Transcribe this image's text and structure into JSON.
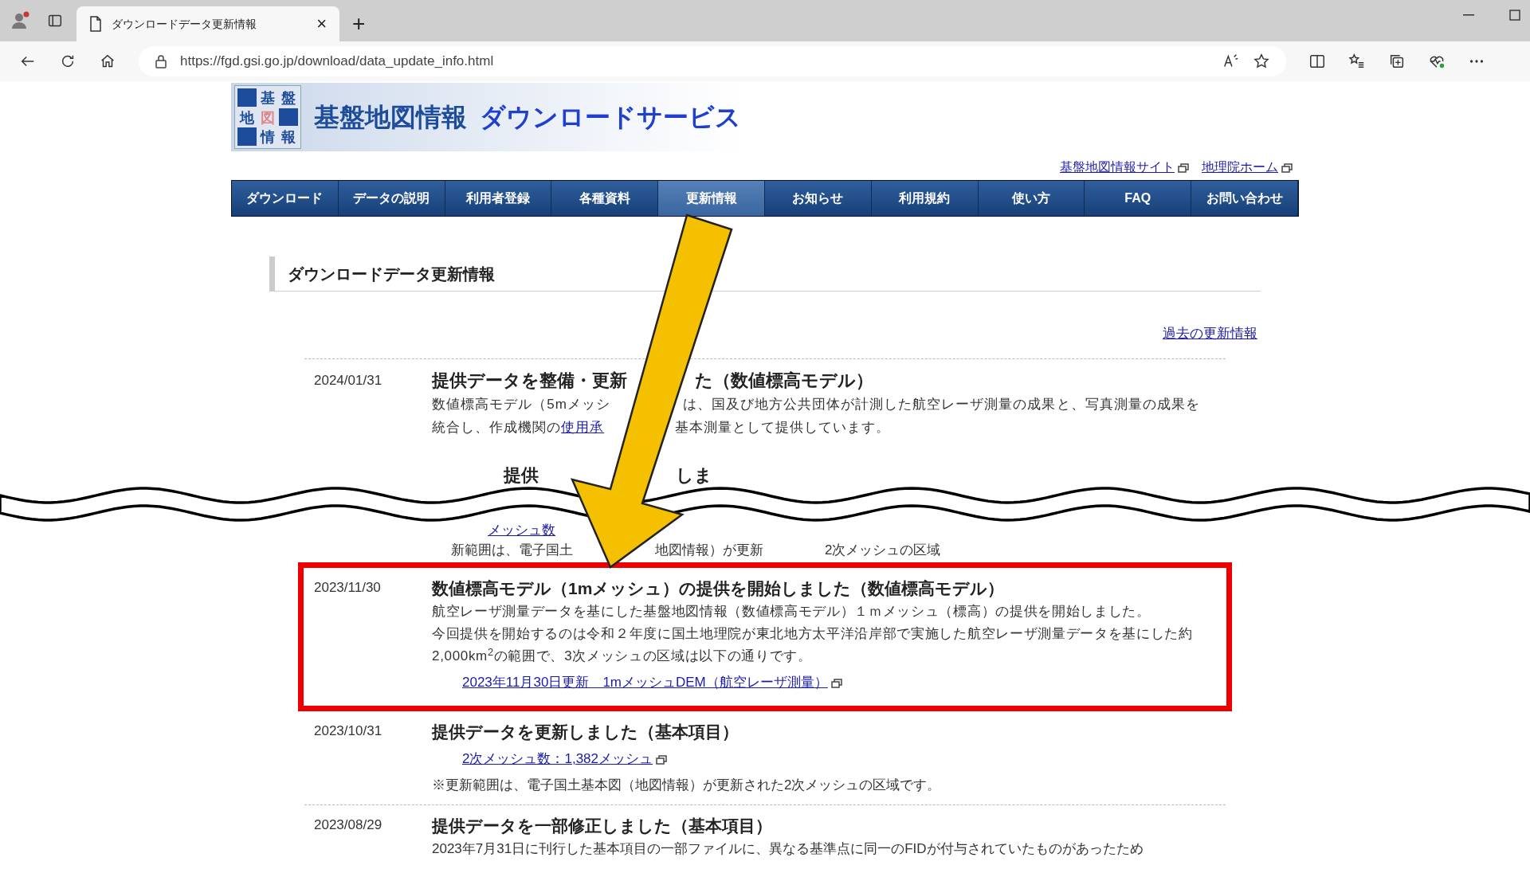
{
  "browser": {
    "tab_title": "ダウンロードデータ更新情報",
    "tab_close": "×",
    "new_tab": "+",
    "url": "https://fgd.gsi.go.jp/download/data_update_info.html"
  },
  "site": {
    "logo_chars": [
      "基",
      "盤",
      "地",
      "図",
      "情",
      "報"
    ],
    "title": "基盤地図情報",
    "subtitle": "ダウンロードサービス",
    "top_links": [
      "基盤地図情報サイト",
      "地理院ホーム"
    ]
  },
  "nav": [
    {
      "label": "ダウンロード",
      "selected": false
    },
    {
      "label": "データの説明",
      "selected": false
    },
    {
      "label": "利用者登録",
      "selected": false
    },
    {
      "label": "各種資料",
      "selected": false
    },
    {
      "label": "更新情報",
      "selected": true
    },
    {
      "label": "お知らせ",
      "selected": false
    },
    {
      "label": "利用規約",
      "selected": false
    },
    {
      "label": "使い方",
      "selected": false
    },
    {
      "label": "FAQ",
      "selected": false
    },
    {
      "label": "お問い合わせ",
      "selected": false
    }
  ],
  "heading": "ダウンロードデータ更新情報",
  "past_link": "過去の更新情報",
  "top_entry": {
    "date": "2024/01/31",
    "title_parts": [
      "提供データを整備・更新",
      "た（数値標高モデル）"
    ],
    "body_lines": [
      [
        {
          "kind": "text",
          "text": "数値標高モデル（5mメッシ"
        },
        {
          "kind": "text",
          "text": "は、国及び地方公共団体が計測した航空レーザ測量の成果と、写真測量の成果を"
        }
      ],
      [
        {
          "kind": "text",
          "text": "統合し、作成機関の"
        },
        {
          "kind": "link",
          "text": "使用承"
        },
        {
          "kind": "text",
          "text": "基本測量として提供しています。"
        }
      ]
    ]
  },
  "cut_fragments": [
    {
      "kind": "title",
      "text": "提供"
    },
    {
      "kind": "title",
      "text": "しま"
    },
    {
      "kind": "link",
      "text": "メッシュ数"
    },
    {
      "kind": "text",
      "text": "新範囲は、電子国土"
    },
    {
      "kind": "text",
      "text": "地図情報）が更新"
    },
    {
      "kind": "text",
      "text": "2次メッシュの区域"
    }
  ],
  "highlighted_entry": {
    "date": "2023/11/30",
    "title": "数値標高モデル（1mメッシュ）の提供を開始しました（数値標高モデル）",
    "body": [
      "航空レーザ測量データを基にした基盤地図情報（数値標高モデル）１ｍメッシュ（標高）の提供を開始しました。",
      "今回提供を開始するのは令和２年度に国土地理院が東北地方太平洋沿岸部で実施した航空レーザ測量データを基にした約2,000km$^{2}$の範囲で、3次メッシュの区域は以下の通りです。"
    ],
    "links": [
      "2023年11月30日更新　1mメッシュDEM（航空レーザ測量）"
    ]
  },
  "entries_bottom": [
    {
      "date": "2023/10/31",
      "title": "提供データを更新しました（基本項目）",
      "links": [
        "2次メッシュ数：1,382メッシュ"
      ],
      "note": "※更新範囲は、電子国土基本図（地図情報）が更新された2次メッシュの区域です。"
    },
    {
      "date": "2023/08/29",
      "title": "提供データを一部修正しました（基本項目）",
      "note": "2023年7月31日に刊行した基本項目の一部ファイルに、異なる基準点に同一のFIDが付与されていたものがあったため"
    }
  ]
}
